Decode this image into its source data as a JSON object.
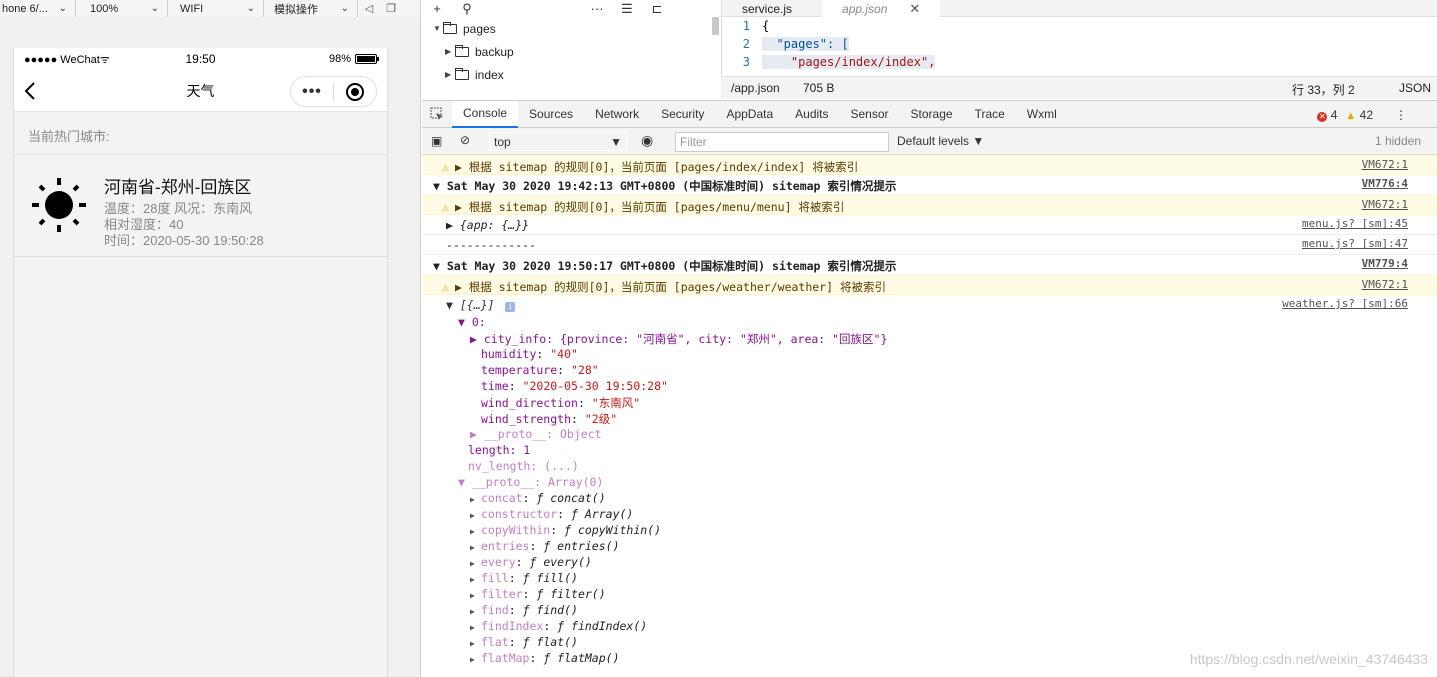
{
  "sim_toolbar": {
    "device": "hone 6/...",
    "zoom": "100%",
    "network": "WIFI",
    "operation": "模拟操作"
  },
  "phone": {
    "carrier": "●●●●● WeChat",
    "time": "19:50",
    "battery": "98%",
    "battery_level": 0.98,
    "nav_title": "天气",
    "hot_label": "当前热门城市:",
    "weather": {
      "city": "河南省-郑州-回族区",
      "temp_wind": "温度：28度 风况：东南风",
      "humidity": "相对湿度：40",
      "time": "时间：2020-05-30 19:50:28",
      "icon": "sun-icon"
    }
  },
  "file_tree": {
    "items": [
      {
        "label": "pages",
        "expanded": true
      },
      {
        "label": "backup",
        "expanded": false
      },
      {
        "label": "index",
        "expanded": false
      }
    ]
  },
  "editor": {
    "tabs": [
      "service.js",
      "app.json"
    ],
    "lines": [
      {
        "no": "1",
        "text": "{"
      },
      {
        "no": "2",
        "text": "  \"pages\": ["
      },
      {
        "no": "3",
        "text": "    \"pages/index/index\","
      }
    ],
    "status": {
      "path": "/app.json",
      "size": "705 B",
      "cursor": "行 33，列 2",
      "lang": "JSON"
    }
  },
  "devtools": {
    "tabs": [
      "Console",
      "Sources",
      "Network",
      "Security",
      "AppData",
      "Audits",
      "Sensor",
      "Storage",
      "Trace",
      "Wxml"
    ],
    "errors": "4",
    "warnings": "42",
    "context": "top",
    "filter_placeholder": "Filter",
    "levels": "Default levels ▼",
    "hidden": "1 hidden"
  },
  "console": {
    "rows": [
      {
        "type": "warn",
        "text": "▶ 根据 sitemap 的规则[0]，当前页面 [pages/index/index] 将被索引",
        "src": "VM672:1"
      },
      {
        "type": "group",
        "text": "▼ Sat May 30 2020 19:42:13 GMT+0800 (中国标准时间) sitemap 索引情况提示",
        "src": "VM776:4"
      },
      {
        "type": "warn",
        "text": "▶ 根据 sitemap 的规则[0]，当前页面 [pages/menu/menu] 将被索引",
        "src": "VM672:1"
      },
      {
        "type": "plain",
        "text": "▶ {app: {…}}",
        "src": "menu.js? [sm]:45"
      },
      {
        "type": "plain",
        "text": "-------------",
        "src": "menu.js? [sm]:47"
      },
      {
        "type": "group",
        "text": "▼ Sat May 30 2020 19:50:17 GMT+0800 (中国标准时间) sitemap 索引情况提示",
        "src": "VM779:4"
      },
      {
        "type": "warn",
        "text": "▶ 根据 sitemap 的规则[0]，当前页面 [pages/weather/weather] 将被索引",
        "src": "VM672:1"
      }
    ],
    "object_src": "weather.js? [sm]:66",
    "object_head": "▼ [{…}]",
    "index0": "▼ 0:",
    "city_info": "▶ city_info: {province: \"河南省\", city: \"郑州\", area: \"回族区\"}",
    "props": [
      {
        "key": "humidity",
        "val": "\"40\""
      },
      {
        "key": "temperature",
        "val": "\"28\""
      },
      {
        "key": "time",
        "val": "\"2020-05-30 19:50:28\""
      },
      {
        "key": "wind_direction",
        "val": "\"东南风\""
      },
      {
        "key": "wind_strength",
        "val": "\"2级\""
      }
    ],
    "proto_obj": "▶ __proto__: Object",
    "length": "length: 1",
    "nv_length": "nv_length: (...)",
    "proto_arr": "▼ __proto__: Array(0)",
    "methods": [
      {
        "key": "concat",
        "fn": "ƒ concat()"
      },
      {
        "key": "constructor",
        "fn": "ƒ Array()"
      },
      {
        "key": "copyWithin",
        "fn": "ƒ copyWithin()"
      },
      {
        "key": "entries",
        "fn": "ƒ entries()"
      },
      {
        "key": "every",
        "fn": "ƒ every()"
      },
      {
        "key": "fill",
        "fn": "ƒ fill()"
      },
      {
        "key": "filter",
        "fn": "ƒ filter()"
      },
      {
        "key": "find",
        "fn": "ƒ find()"
      },
      {
        "key": "findIndex",
        "fn": "ƒ findIndex()"
      },
      {
        "key": "flat",
        "fn": "ƒ flat()"
      },
      {
        "key": "flatMap",
        "fn": "ƒ flatMap()"
      }
    ]
  },
  "watermark": "https://blog.csdn.net/weixin_43746433"
}
